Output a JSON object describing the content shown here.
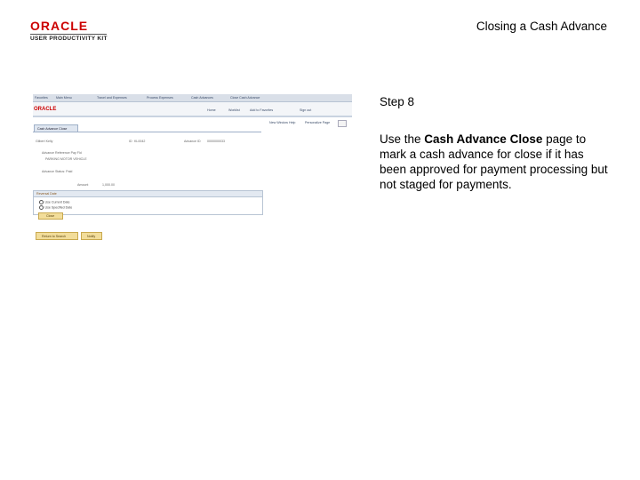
{
  "header": {
    "logo_brand": "ORACLE",
    "logo_product": "USER PRODUCTIVITY KIT",
    "title": "Closing a Cash Advance"
  },
  "step": {
    "label": "Step 8",
    "text_before": "Use the ",
    "text_bold": "Cash Advance Close",
    "text_after": " page to mark a cash advance for close if it has been approved for payment processing but not staged for payments."
  },
  "screenshot": {
    "nav": [
      "Favorites",
      "Main Menu",
      "Travel and Expenses",
      "Process Expenses",
      "Cash Advances",
      "Close Cash Advance"
    ],
    "brand": "ORACLE",
    "header_links": [
      "Home",
      "Worklist",
      "Add to Favorites",
      "Sign out"
    ],
    "page_links": [
      "New Window",
      "Help",
      "Personalize Page"
    ],
    "tab": "Cash Advance Close",
    "fields": {
      "employee_label": "Gilbert Kelly",
      "id_label": "ID",
      "id_value": "KL0042",
      "advance_label": "Advance ID",
      "advance_value": "0000000033",
      "line1": "Advance Reference Pay Fld",
      "line2": "PARKING MOTOR VEHICLE",
      "line3": "Advance Status: Paid",
      "line4": "Amount",
      "amount_value": "1,000.00"
    },
    "group_title": "Reversal Date",
    "radio1": "Use Current Date",
    "radio2": "Use Specified Date",
    "go_button": "Close",
    "bottom_buttons": [
      "Return to Search",
      "Notify"
    ]
  }
}
